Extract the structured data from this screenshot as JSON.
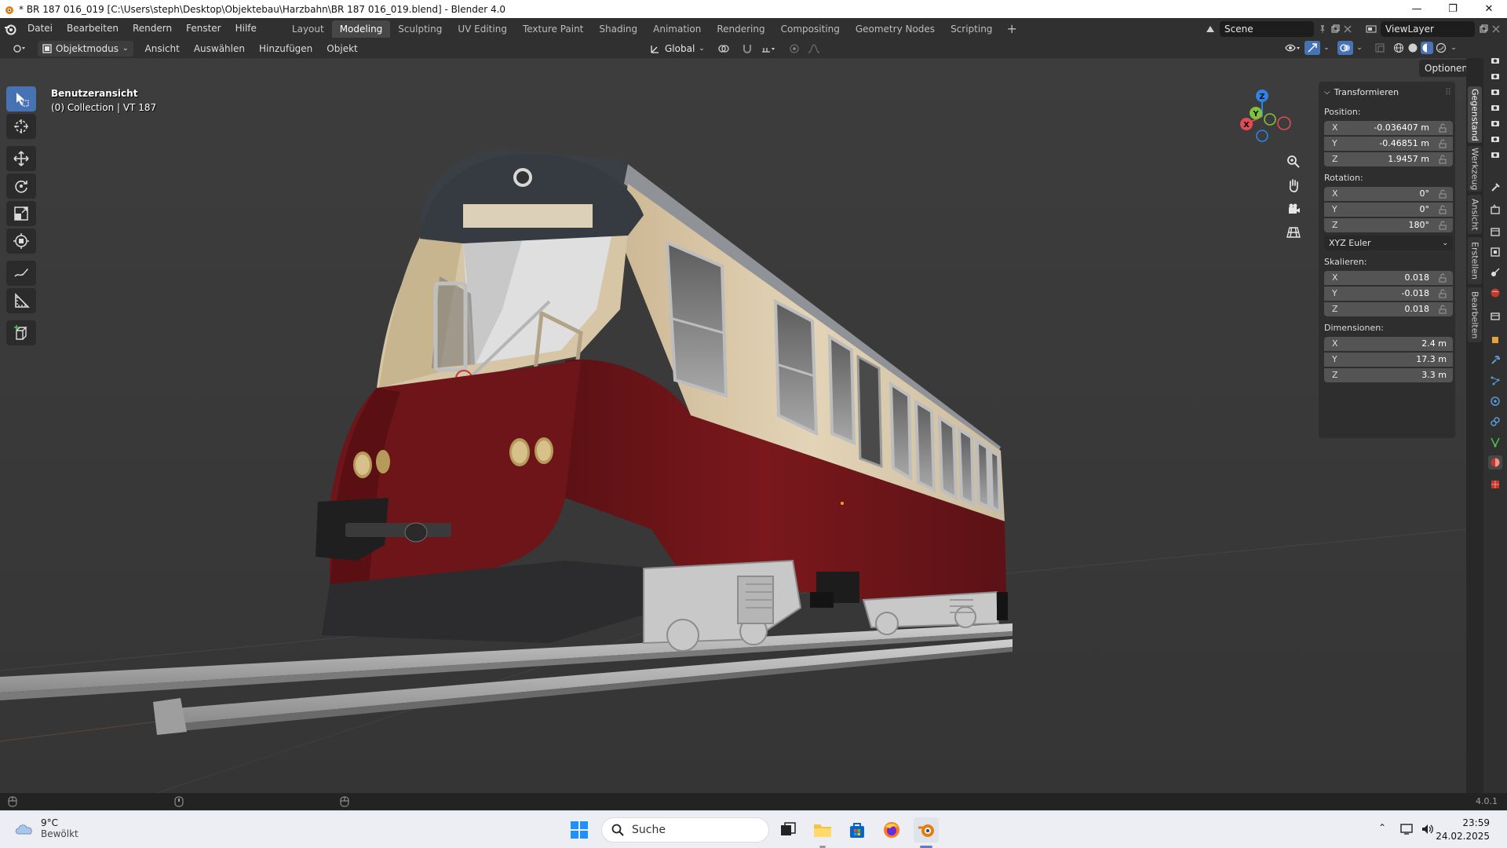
{
  "window": {
    "title": "* BR 187 016_019 [C:\\Users\\steph\\Desktop\\Objektebau\\Harzbahn\\BR 187 016_019.blend] - Blender 4.0",
    "minimize_glyph": "—",
    "maximize_glyph": "❐",
    "close_glyph": "✕"
  },
  "menu": [
    "Datei",
    "Bearbeiten",
    "Rendern",
    "Fenster",
    "Hilfe"
  ],
  "workspaces": {
    "tabs": [
      "Layout",
      "Modeling",
      "Sculpting",
      "UV Editing",
      "Texture Paint",
      "Shading",
      "Animation",
      "Rendering",
      "Compositing",
      "Geometry Nodes",
      "Scripting"
    ],
    "active": "Modeling",
    "add_glyph": "+"
  },
  "scene": {
    "name": "Scene",
    "view_layer": "ViewLayer"
  },
  "viewport_header": {
    "mode": "Objektmodus",
    "menus": [
      "Ansicht",
      "Auswählen",
      "Hinzufügen",
      "Objekt"
    ],
    "orientation": "Global",
    "options_label": "Optionen"
  },
  "viewport": {
    "view_name": "Benutzeransicht",
    "collection": "(0) Collection | VT 187"
  },
  "gizmo": {
    "x": "X",
    "y": "Y",
    "z": "Z"
  },
  "npanel": {
    "section": "Transformieren",
    "position_label": "Position:",
    "position": [
      {
        "axis": "X",
        "value": "-0.036407 m"
      },
      {
        "axis": "Y",
        "value": "-0.46851 m"
      },
      {
        "axis": "Z",
        "value": "1.9457 m"
      }
    ],
    "rotation_label": "Rotation:",
    "rotation": [
      {
        "axis": "X",
        "value": "0°"
      },
      {
        "axis": "Y",
        "value": "0°"
      },
      {
        "axis": "Z",
        "value": "180°"
      }
    ],
    "rotation_mode": "XYZ Euler",
    "scale_label": "Skalieren:",
    "scale": [
      {
        "axis": "X",
        "value": "0.018"
      },
      {
        "axis": "Y",
        "value": "-0.018"
      },
      {
        "axis": "Z",
        "value": "0.018"
      }
    ],
    "dimensions_label": "Dimensionen:",
    "dimensions": [
      {
        "axis": "X",
        "value": "2.4 m"
      },
      {
        "axis": "Y",
        "value": "17.3 m"
      },
      {
        "axis": "Z",
        "value": "3.3 m"
      }
    ]
  },
  "side_tabs": [
    "Gegenstand",
    "Werkzeug",
    "Ansicht",
    "Erstellen",
    "Bearbeiten"
  ],
  "statusbar": {
    "version": "4.0.1"
  },
  "taskbar": {
    "temperature": "9°C",
    "weather": "Bewölkt",
    "search_placeholder": "Suche",
    "time": "23:59",
    "date": "24.02.2025"
  },
  "colors": {
    "accent": "#4772b3",
    "train_red": "#6e1519",
    "train_cream": "#d9c8a8",
    "roof": "#3a3f45"
  }
}
